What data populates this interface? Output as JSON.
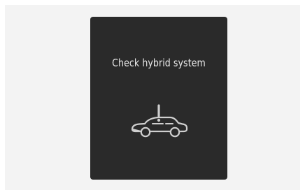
{
  "display": {
    "message": "Check hybrid system",
    "icon": "car-warning-icon",
    "colors": {
      "panel_background": "#2a2a2a",
      "text": "#e9e9e9",
      "icon": "#cfcfcf",
      "surround": "#f3f3f3"
    }
  }
}
